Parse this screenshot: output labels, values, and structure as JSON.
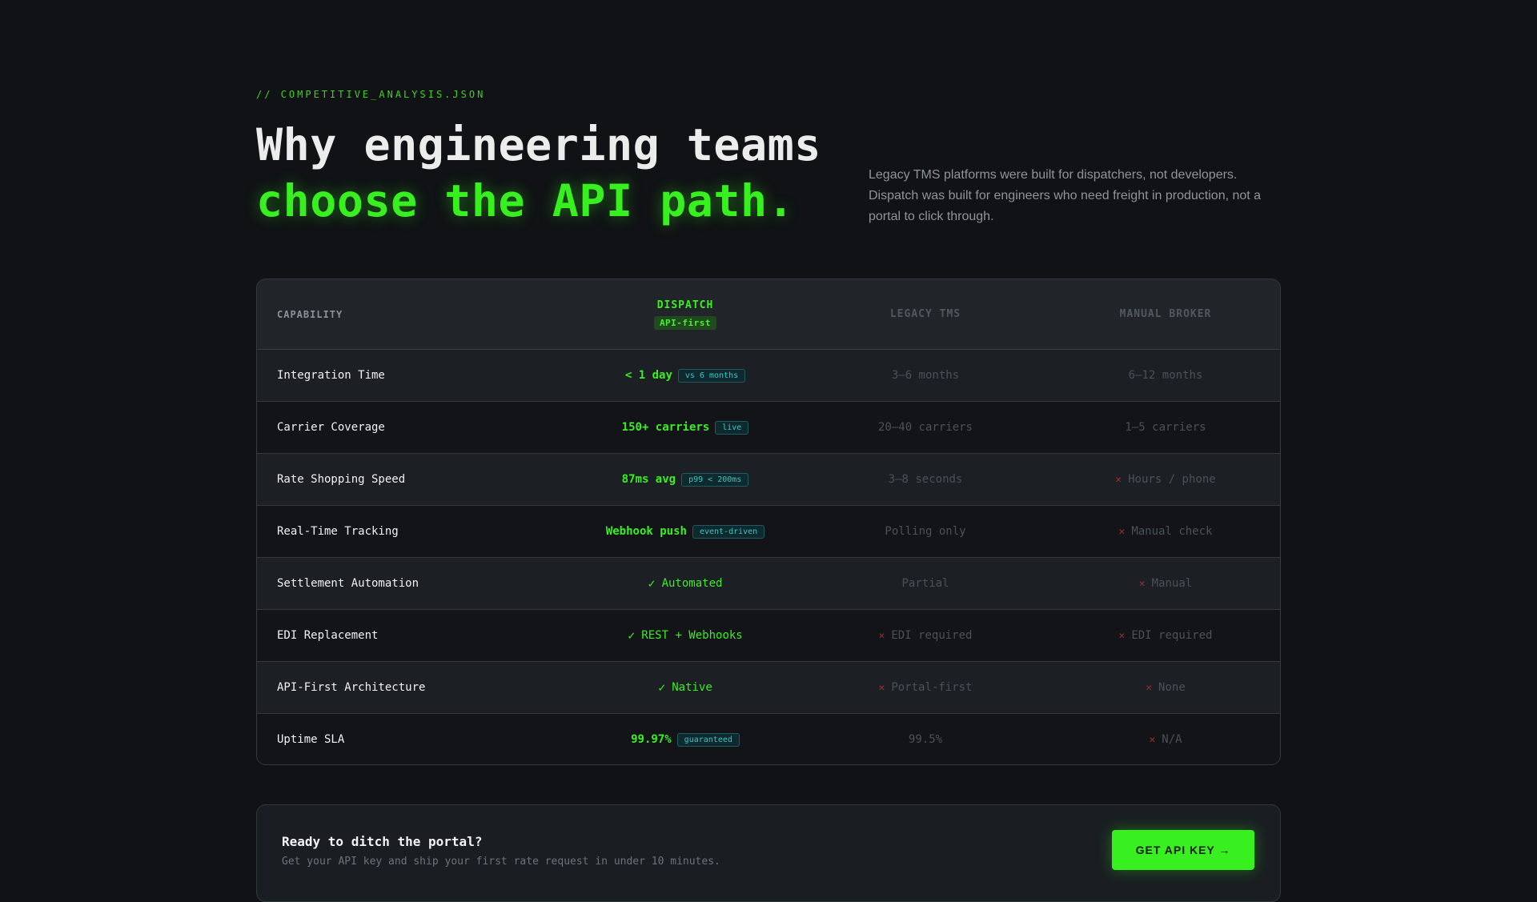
{
  "header": {
    "eyebrow": "// COMPETITIVE_ANALYSIS.JSON",
    "title_line1": "Why engineering teams",
    "title_line2": "choose the API path.",
    "lead": "Legacy TMS platforms were built for dispatchers, not developers. Dispatch was built for engineers who need freight in production, not a portal to click through."
  },
  "table": {
    "columns": {
      "capability": "CAPABILITY",
      "dispatch": "DISPATCH",
      "dispatch_pill": "API-first",
      "legacy": "LEGACY TMS",
      "broker": "MANUAL BROKER"
    },
    "rows": [
      {
        "capability": "Integration Time",
        "dispatch": "< 1 day",
        "dispatch_badge": "vs 6 months",
        "legacy": "3–6 months",
        "broker": "6–12 months"
      },
      {
        "capability": "Carrier Coverage",
        "dispatch": "150+ carriers",
        "dispatch_badge": "live",
        "legacy": "20–40 carriers",
        "broker": "1–5 carriers"
      },
      {
        "capability": "Rate Shopping Speed",
        "dispatch": "87ms avg",
        "dispatch_badge": "p99 < 200ms",
        "legacy": "3–8 seconds",
        "broker": "Hours / phone"
      },
      {
        "capability": "Real-Time Tracking",
        "dispatch": "Webhook push",
        "dispatch_badge": "event-driven",
        "legacy": "Polling only",
        "broker": "Manual check"
      },
      {
        "capability": "Settlement Automation",
        "dispatch": "Automated",
        "legacy": "Partial",
        "broker": "Manual"
      },
      {
        "capability": "EDI Replacement",
        "dispatch": "REST + Webhooks",
        "legacy": "EDI required",
        "broker": "EDI required"
      },
      {
        "capability": "API-First Architecture",
        "dispatch": "Native",
        "legacy": "Portal-first",
        "broker": "None"
      },
      {
        "capability": "Uptime SLA",
        "dispatch": "99.97%",
        "dispatch_badge": "guaranteed",
        "legacy": "99.5%",
        "broker": "N/A"
      }
    ]
  },
  "cta": {
    "title": "Ready to ditch the portal?",
    "subtitle": "Get your API key and ship your first rate request in under 10 minutes.",
    "button": "GET API KEY →"
  },
  "icons": {
    "check": "check-icon",
    "cross": "x-icon"
  },
  "colors": {
    "accent": "#38f01f",
    "background": "#101215",
    "badge": "#35c7c8",
    "negative": "#9a2f2f"
  }
}
